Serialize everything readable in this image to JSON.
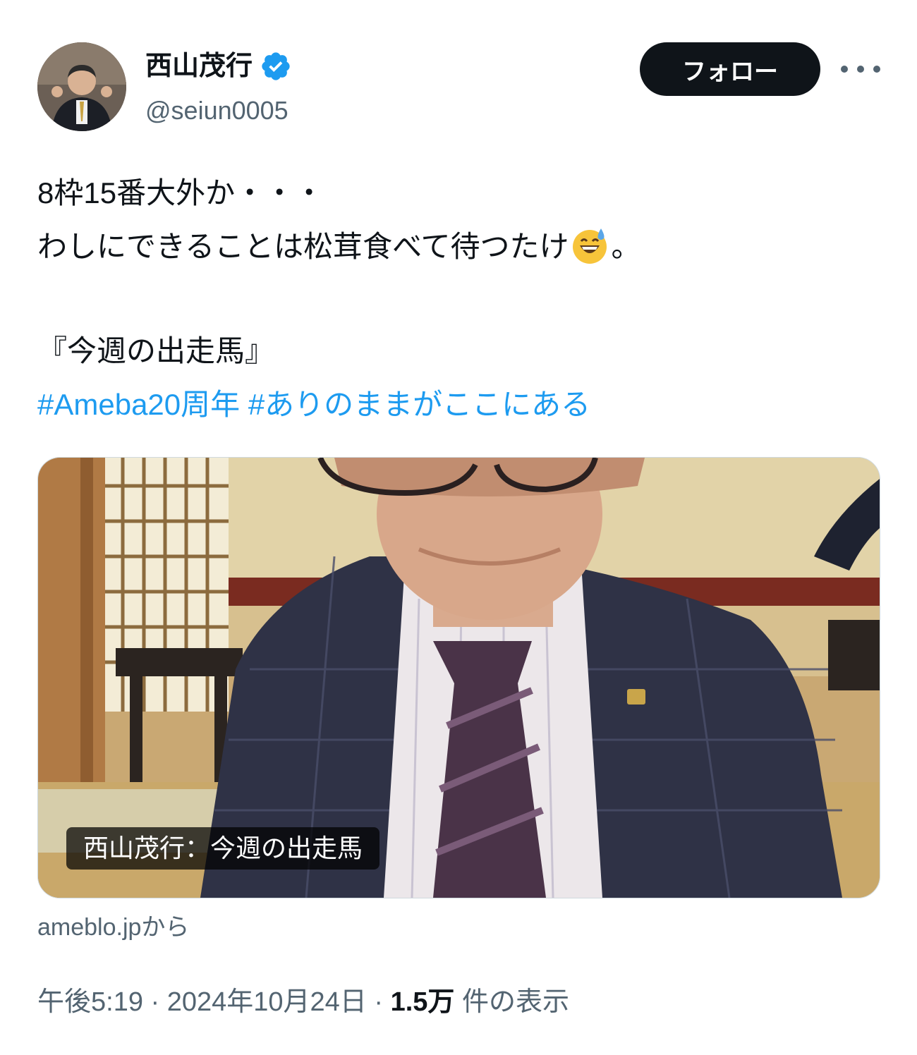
{
  "user": {
    "display_name": "西山茂行",
    "handle": "@seiun0005",
    "verified_icon": "verified-badge-icon",
    "verified_color": "#1d9bf0"
  },
  "actions": {
    "follow_label": "フォロー",
    "more_icon": "more-options-icon"
  },
  "post": {
    "line1": "8枠15番大外か・・・",
    "line2_before": "わしにできることは松茸食べて待つたけ",
    "line2_emoji": "grinning-face-with-sweat-emoji",
    "line2_after": "。",
    "line3": "『今週の出走馬』",
    "hashtags": [
      "#Ameba20周年",
      "#ありのままがここにある"
    ]
  },
  "link_card": {
    "title": "西山茂行：今週の出走馬",
    "source": "ameblo.jpから"
  },
  "meta": {
    "time": "午後5:19",
    "separator": "·",
    "date": "2024年10月24日",
    "views_count": "1.5万",
    "views_label": "件の表示"
  },
  "colors": {
    "text": "#0f1419",
    "secondary": "#536471",
    "link": "#1d9bf0",
    "button_bg": "#0f1419"
  }
}
